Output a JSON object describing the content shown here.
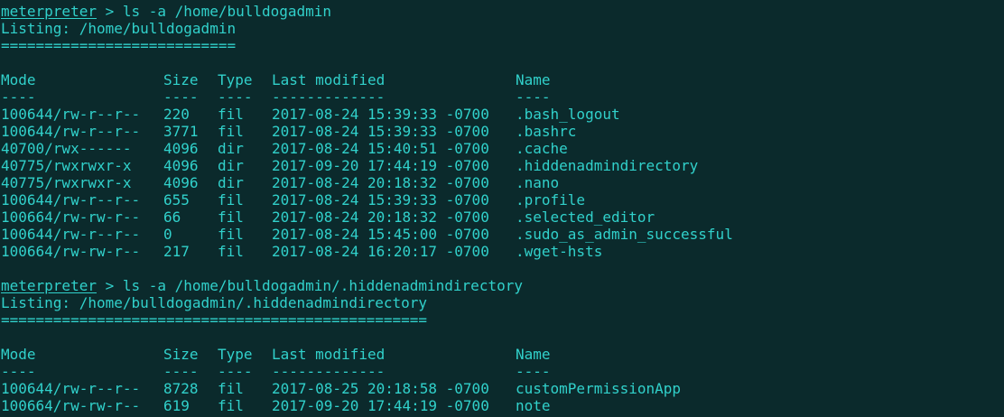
{
  "colors": {
    "background": "#0b2a2c",
    "text": "#31d1cb"
  },
  "blocks": [
    {
      "prompt": "meterpreter",
      "command": " > ls -a /home/bulldogadmin",
      "listing": "Listing: /home/bulldogadmin",
      "separator": "===========================",
      "headers": {
        "mode": "Mode",
        "size": "Size",
        "type": "Type",
        "modified": "Last modified",
        "name": "Name"
      },
      "dashes": {
        "mode": "----",
        "size": "----",
        "type": "----",
        "modified": "-------------",
        "name": "----"
      },
      "rows": [
        {
          "mode": "100644/rw-r--r--",
          "size": "220",
          "type": "fil",
          "modified": "2017-08-24 15:39:33 -0700",
          "name": ".bash_logout"
        },
        {
          "mode": "100644/rw-r--r--",
          "size": "3771",
          "type": "fil",
          "modified": "2017-08-24 15:39:33 -0700",
          "name": ".bashrc"
        },
        {
          "mode": "40700/rwx------",
          "size": "4096",
          "type": "dir",
          "modified": "2017-08-24 15:40:51 -0700",
          "name": ".cache"
        },
        {
          "mode": "40775/rwxrwxr-x",
          "size": "4096",
          "type": "dir",
          "modified": "2017-09-20 17:44:19 -0700",
          "name": ".hiddenadmindirectory"
        },
        {
          "mode": "40775/rwxrwxr-x",
          "size": "4096",
          "type": "dir",
          "modified": "2017-08-24 20:18:32 -0700",
          "name": ".nano"
        },
        {
          "mode": "100644/rw-r--r--",
          "size": "655",
          "type": "fil",
          "modified": "2017-08-24 15:39:33 -0700",
          "name": ".profile"
        },
        {
          "mode": "100664/rw-rw-r--",
          "size": "66",
          "type": "fil",
          "modified": "2017-08-24 20:18:32 -0700",
          "name": ".selected_editor"
        },
        {
          "mode": "100644/rw-r--r--",
          "size": "0",
          "type": "fil",
          "modified": "2017-08-24 15:45:00 -0700",
          "name": ".sudo_as_admin_successful"
        },
        {
          "mode": "100664/rw-rw-r--",
          "size": "217",
          "type": "fil",
          "modified": "2017-08-24 16:20:17 -0700",
          "name": ".wget-hsts"
        }
      ]
    },
    {
      "prompt": "meterpreter",
      "command": " > ls -a /home/bulldogadmin/.hiddenadmindirectory",
      "listing": "Listing: /home/bulldogadmin/.hiddenadmindirectory",
      "separator": "=================================================",
      "headers": {
        "mode": "Mode",
        "size": "Size",
        "type": "Type",
        "modified": "Last modified",
        "name": "Name"
      },
      "dashes": {
        "mode": "----",
        "size": "----",
        "type": "----",
        "modified": "-------------",
        "name": "----"
      },
      "rows": [
        {
          "mode": "100644/rw-r--r--",
          "size": "8728",
          "type": "fil",
          "modified": "2017-08-25 20:18:58 -0700",
          "name": "customPermissionApp"
        },
        {
          "mode": "100664/rw-rw-r--",
          "size": "619",
          "type": "fil",
          "modified": "2017-09-20 17:44:19 -0700",
          "name": "note"
        }
      ]
    }
  ]
}
